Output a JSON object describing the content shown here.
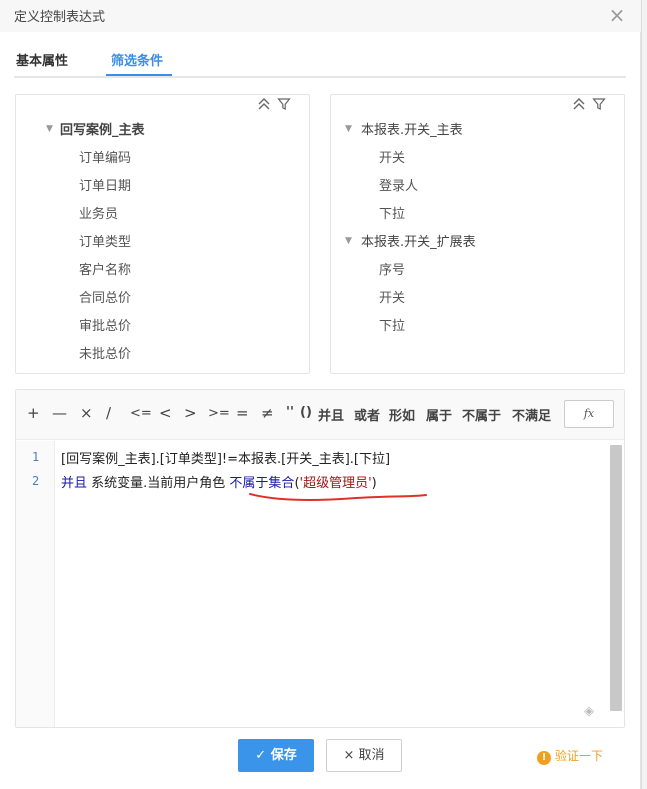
{
  "dialog": {
    "title": "定义控制表达式",
    "close_glyph": "×"
  },
  "tabs": [
    {
      "label": "基本属性",
      "active": false
    },
    {
      "label": "筛选条件",
      "active": true
    }
  ],
  "tree_left": {
    "tools": [
      "collapse-all-icon",
      "filter-icon"
    ],
    "group": "回写案例_主表",
    "items": [
      "订单编码",
      "订单日期",
      "业务员",
      "订单类型",
      "客户名称",
      "合同总价",
      "审批总价",
      "未批总价"
    ]
  },
  "tree_right": {
    "tools": [
      "collapse-all-icon",
      "filter-icon"
    ],
    "groups": [
      {
        "label": "本报表.开关_主表",
        "items": [
          "开关",
          "登录人",
          "下拉"
        ]
      },
      {
        "label": "本报表.开关_扩展表",
        "items": [
          "序号",
          "开关",
          "下拉"
        ]
      }
    ]
  },
  "operators": [
    "+",
    "—",
    "×",
    "∕",
    "<=",
    "<",
    ">",
    ">=",
    "=",
    "≠",
    "''",
    "()",
    "并且",
    "或者",
    "形如",
    "属于",
    "不属于",
    "不满足"
  ],
  "fx_label": "fx",
  "code": {
    "line_numbers": [
      "1",
      "2"
    ],
    "line1": "[回写案例_主表].[订单类型]!=本报表.[开关_主表].[下拉]",
    "line2_kw": "并且",
    "line2_text": " 系统变量.当前用户角色 ",
    "line2_fn": "不属于集合",
    "line2_open": "(",
    "line2_str": "'超级管理员'",
    "line2_close": ")"
  },
  "footer": {
    "save_label": "保存",
    "cancel_label": "取消",
    "verify_label": "验证一下",
    "save_icon": "✓",
    "cancel_icon": "×",
    "verify_icon": "!"
  },
  "colors": {
    "accent": "#3a8ee6",
    "primary_button": "#3a95ea",
    "keyword": "#1a1aa6",
    "string": "#a31515",
    "warning": "#f0a020",
    "annotation": "#e0302a"
  }
}
